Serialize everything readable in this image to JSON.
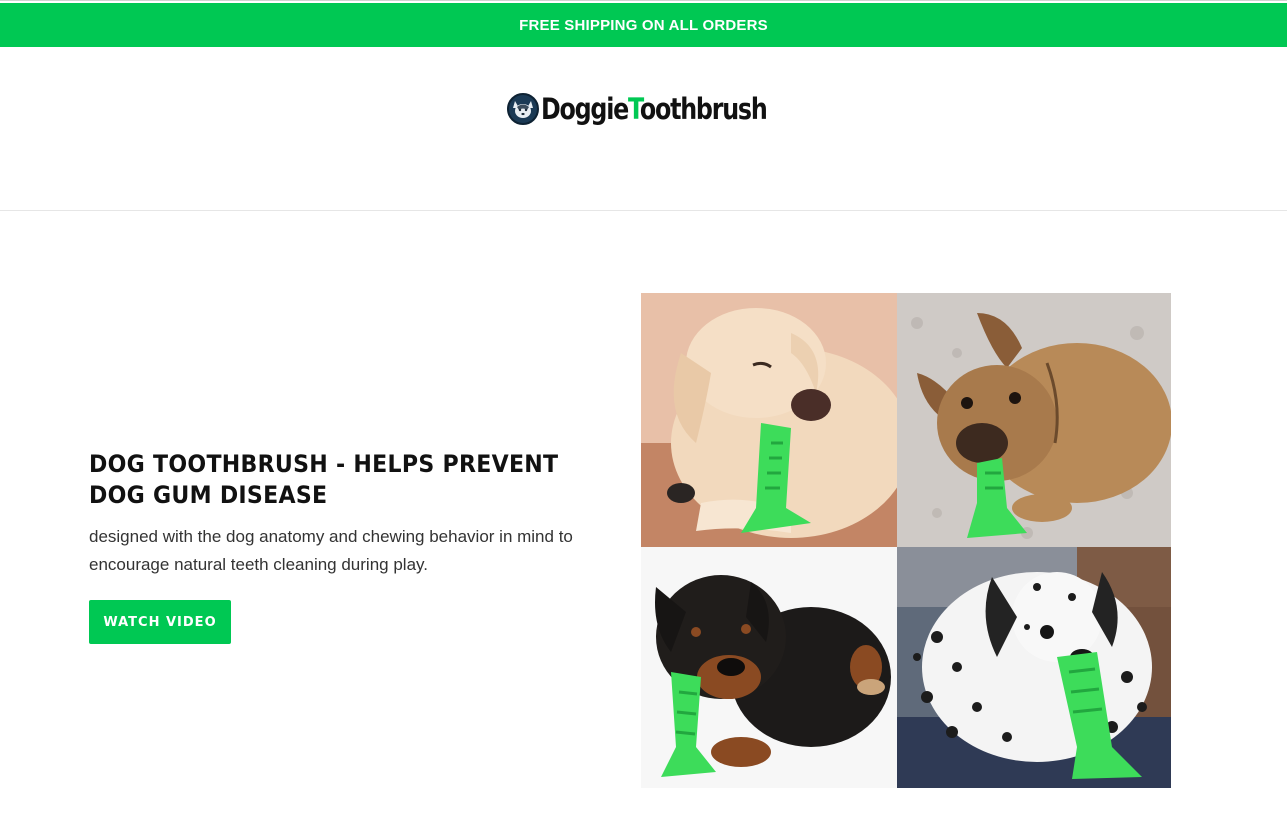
{
  "colors": {
    "brand_green": "#00c853",
    "toy_green": "#3ddc5a",
    "text_dark": "#111111"
  },
  "announcement": {
    "text": "FREE SHIPPING ON ALL ORDERS"
  },
  "header": {
    "logo_icon": "husky-icon",
    "logo_text_part1": "Doggie",
    "logo_text_accent": "T",
    "logo_text_part2": "oothbrush"
  },
  "hero": {
    "title": "DOG TOOTHBRUSH - HELPS PREVENT DOG GUM DISEASE",
    "subtitle": "designed with the dog anatomy and chewing behavior in mind to encourage natural teeth cleaning during play.",
    "cta_label": "WATCH VIDEO"
  },
  "collage": {
    "tiles": [
      {
        "name": "labrador-photo"
      },
      {
        "name": "french-bulldog-photo"
      },
      {
        "name": "rottweiler-photo"
      },
      {
        "name": "dalmatian-photo"
      }
    ]
  }
}
